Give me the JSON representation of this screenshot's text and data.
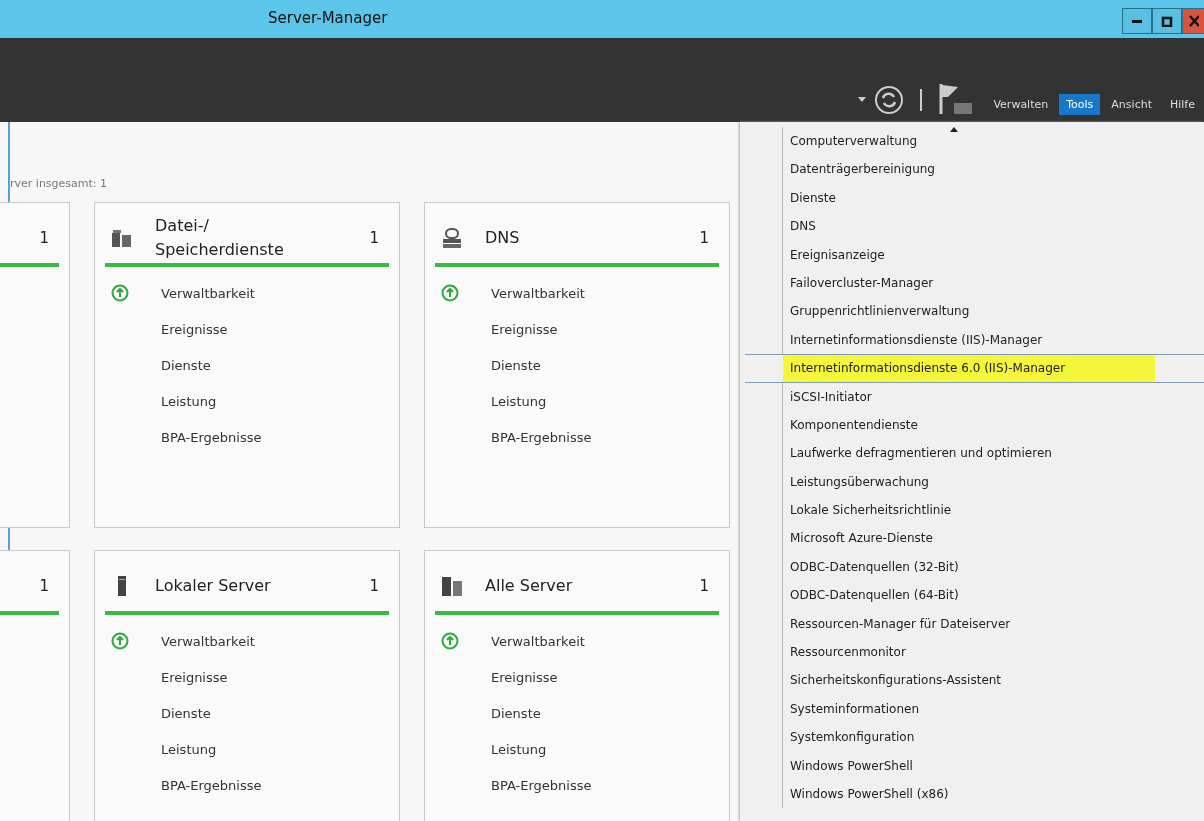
{
  "window": {
    "title": "Server-Manager"
  },
  "toolbar": {
    "menus": [
      {
        "label": "Verwalten",
        "selected": false
      },
      {
        "label": "Tools",
        "selected": true
      },
      {
        "label": "Ansicht",
        "selected": false
      },
      {
        "label": "Hilfe",
        "selected": false
      }
    ]
  },
  "dashboard": {
    "subtitle": "rver insgesamt: 1",
    "rows": [
      {
        "cards": [
          {
            "count": "1"
          },
          {
            "kind": "files",
            "title": "Datei-/ Speicherdienste",
            "count": "1",
            "items": [
              {
                "label": "Verwaltbarkeit",
                "healthy": true
              },
              {
                "label": "Ereignisse",
                "healthy": false
              },
              {
                "label": "Dienste",
                "healthy": false
              },
              {
                "label": "Leistung",
                "healthy": false
              },
              {
                "label": "BPA-Ergebnisse",
                "healthy": false
              }
            ]
          },
          {
            "kind": "dns",
            "title": "DNS",
            "count": "1",
            "items": [
              {
                "label": "Verwaltbarkeit",
                "healthy": true
              },
              {
                "label": "Ereignisse",
                "healthy": false
              },
              {
                "label": "Dienste",
                "healthy": false
              },
              {
                "label": "Leistung",
                "healthy": false
              },
              {
                "label": "BPA-Ergebnisse",
                "healthy": false
              }
            ]
          }
        ]
      },
      {
        "cards": [
          {
            "count": "1"
          },
          {
            "kind": "server",
            "title": "Lokaler Server",
            "count": "1",
            "items": [
              {
                "label": "Verwaltbarkeit",
                "healthy": true
              },
              {
                "label": "Ereignisse",
                "healthy": false
              },
              {
                "label": "Dienste",
                "healthy": false
              },
              {
                "label": "Leistung",
                "healthy": false
              },
              {
                "label": "BPA-Ergebnisse",
                "healthy": false
              }
            ]
          },
          {
            "kind": "servers",
            "title": "Alle Server",
            "count": "1",
            "items": [
              {
                "label": "Verwaltbarkeit",
                "healthy": true
              },
              {
                "label": "Ereignisse",
                "healthy": false
              },
              {
                "label": "Dienste",
                "healthy": false
              },
              {
                "label": "Leistung",
                "healthy": false
              },
              {
                "label": "BPA-Ergebnisse",
                "healthy": false
              }
            ]
          }
        ]
      }
    ]
  },
  "tools_menu": {
    "items": [
      {
        "label": "Computerverwaltung",
        "selected": false
      },
      {
        "label": "Datenträgerbereinigung",
        "selected": false
      },
      {
        "label": "Dienste",
        "selected": false
      },
      {
        "label": "DNS",
        "selected": false
      },
      {
        "label": "Ereignisanzeige",
        "selected": false
      },
      {
        "label": "Failovercluster-Manager",
        "selected": false
      },
      {
        "label": "Gruppenrichtlinienverwaltung",
        "selected": false
      },
      {
        "label": "Internetinformationsdienste (IIS)-Manager",
        "selected": false
      },
      {
        "label": "Internetinformationsdienste 6.0 (IIS)-Manager",
        "selected": true
      },
      {
        "label": "iSCSI-Initiator",
        "selected": false
      },
      {
        "label": "Komponentendienste",
        "selected": false
      },
      {
        "label": "Laufwerke defragmentieren und optimieren",
        "selected": false
      },
      {
        "label": "Leistungsüberwachung",
        "selected": false
      },
      {
        "label": "Lokale Sicherheitsrichtlinie",
        "selected": false
      },
      {
        "label": "Microsoft Azure-Dienste",
        "selected": false
      },
      {
        "label": "ODBC-Datenquellen (32-Bit)",
        "selected": false
      },
      {
        "label": "ODBC-Datenquellen (64-Bit)",
        "selected": false
      },
      {
        "label": "Ressourcen-Manager für Dateiserver",
        "selected": false
      },
      {
        "label": "Ressourcenmonitor",
        "selected": false
      },
      {
        "label": "Sicherheitskonfigurations-Assistent",
        "selected": false
      },
      {
        "label": "Systeminformationen",
        "selected": false
      },
      {
        "label": "Systemkonfiguration",
        "selected": false
      },
      {
        "label": "Windows PowerShell",
        "selected": false
      },
      {
        "label": "Windows PowerShell (x86)",
        "selected": false
      }
    ]
  }
}
